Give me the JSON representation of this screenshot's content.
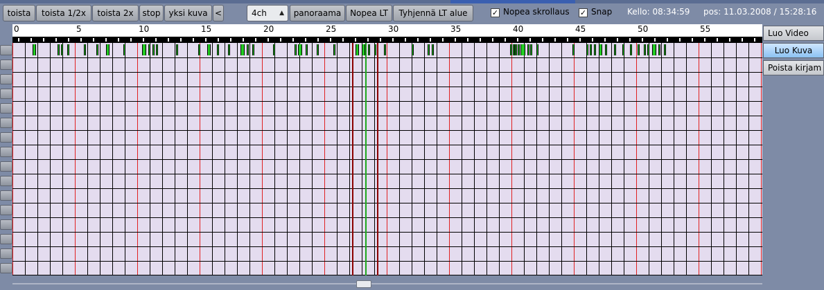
{
  "toolbar": {
    "play": "toista",
    "play_half": "toista 1/2x",
    "play_double": "toista 2x",
    "stop": "stop",
    "single_frame": "yksi kuva",
    "prev": "<",
    "channels": "4ch",
    "panorama": "panoraama",
    "fast_lt": "Nopea LT",
    "clear_lt": "Tyhjennä LT alue",
    "fast_scroll_label": "Nopea skrollaus",
    "fast_scroll_checked": true,
    "snap_label": "Snap",
    "snap_checked": true,
    "clock": "Kello: 08:34:59",
    "position": "pos: 11.03.2008 / 15:28:16"
  },
  "timeline": {
    "ruler_ticks": [
      "0",
      "5",
      "10",
      "15",
      "20",
      "25",
      "30",
      "35",
      "40",
      "45",
      "50",
      "55"
    ],
    "tick_step": 5,
    "max_value": 60,
    "row_count": 16,
    "events": [
      [
        1.6,
        0.3
      ],
      [
        3.6,
        0.1
      ],
      [
        3.9,
        0.1
      ],
      [
        4.4,
        0.1
      ],
      [
        5.7,
        0.1
      ],
      [
        6.7,
        0.1
      ],
      [
        7.5,
        0.3
      ],
      [
        8.9,
        0.1
      ],
      [
        10.4,
        0.3
      ],
      [
        10.9,
        0.1
      ],
      [
        11.2,
        0.1
      ],
      [
        11.5,
        0.1
      ],
      [
        13.1,
        0.1
      ],
      [
        14.9,
        0.1
      ],
      [
        15.6,
        0.3
      ],
      [
        16.4,
        0.1
      ],
      [
        17.3,
        0.1
      ],
      [
        18.3,
        0.3
      ],
      [
        18.8,
        0.1
      ],
      [
        19.2,
        0.1
      ],
      [
        20.9,
        0.1
      ],
      [
        22.6,
        0.1
      ],
      [
        22.9,
        0.3
      ],
      [
        23.5,
        0.1
      ],
      [
        24.4,
        0.1
      ],
      [
        25.7,
        0.1
      ],
      [
        27.5,
        0.3
      ],
      [
        28.0,
        0.3
      ],
      [
        28.5,
        0.1
      ],
      [
        29.0,
        0.1
      ],
      [
        29.8,
        0.1
      ],
      [
        32.0,
        0.1
      ],
      [
        33.3,
        0.1
      ],
      [
        33.6,
        0.1
      ],
      [
        39.9,
        0.1
      ],
      [
        40.1,
        0.1
      ],
      [
        40.3,
        0.1
      ],
      [
        40.5,
        0.1
      ],
      [
        40.7,
        0.4
      ],
      [
        41.3,
        0.1
      ],
      [
        41.5,
        0.1
      ],
      [
        42.0,
        0.1
      ],
      [
        44.9,
        0.1
      ],
      [
        46.0,
        0.1
      ],
      [
        46.3,
        0.1
      ],
      [
        46.6,
        0.1
      ],
      [
        47.0,
        0.3
      ],
      [
        47.5,
        0.1
      ],
      [
        48.2,
        0.1
      ],
      [
        48.9,
        0.1
      ],
      [
        49.5,
        0.1
      ],
      [
        50.1,
        0.1
      ],
      [
        50.6,
        0.1
      ],
      [
        50.9,
        0.1
      ],
      [
        51.3,
        0.3
      ],
      [
        51.8,
        0.1
      ],
      [
        52.2,
        0.1
      ]
    ],
    "cursors": [
      {
        "pos": 27.2,
        "color": "#8b0000"
      },
      {
        "pos": 28.3,
        "color": "#1ea81e"
      },
      {
        "pos": 29.2,
        "color": "#8b0000"
      }
    ]
  },
  "side": {
    "create_video": "Luo Video",
    "create_image": "Luo Kuva",
    "delete_bookmark": "Poista kirjam"
  },
  "colors": {
    "grid_bg": "#e4dcef",
    "major_line": "#e02020",
    "event_fill": "#22cc22",
    "window_bg": "#7e8ba6"
  }
}
